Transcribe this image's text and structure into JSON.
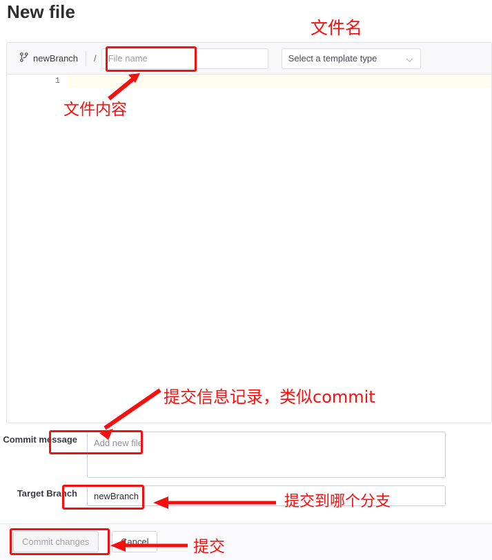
{
  "page": {
    "title": "New file"
  },
  "editor": {
    "branch": {
      "icon": "git-branch-icon",
      "name": "newBranch"
    },
    "path_separator": "/",
    "filename": {
      "value": "",
      "placeholder": "File name"
    },
    "template": {
      "selected": "Select a template type",
      "caret_icon": "chevron-down-icon"
    },
    "lines": [
      {
        "number": "1",
        "content": ""
      }
    ]
  },
  "commit_form": {
    "message": {
      "label": "Commit message",
      "value": "",
      "placeholder": "Add new file"
    },
    "target_branch": {
      "label": "Target Branch",
      "value": "newBranch",
      "placeholder": ""
    }
  },
  "footer": {
    "commit_button": "Commit changes",
    "cancel_button": "Cancel"
  },
  "annotations": {
    "color": "#fa0f0f",
    "items": [
      {
        "name": "annotation-file-name",
        "text": "文件名"
      },
      {
        "name": "annotation-file-content",
        "text": "文件内容"
      },
      {
        "name": "annotation-commit-message",
        "text": "提交信息记录，类似commit"
      },
      {
        "name": "annotation-target-branch",
        "text": "提交到哪个分支"
      },
      {
        "name": "annotation-submit",
        "text": "提交"
      }
    ]
  }
}
